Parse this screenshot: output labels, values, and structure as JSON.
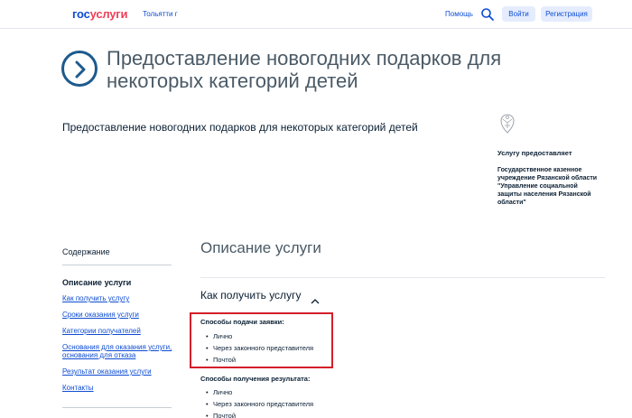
{
  "header": {
    "logo_part1": "гос",
    "logo_part2": "услуги",
    "city": "Тольятти г",
    "help": "Помощь",
    "login": "Войти",
    "register": "Регистрация"
  },
  "page": {
    "title": "Предоставление новогодних подарков для некоторых категорий детей",
    "subheading": "Предоставление новогодних подарков для некоторых категорий детей"
  },
  "provider": {
    "label": "Услугу предоставляет",
    "name": "Государственное казенное учреждение Рязанской области \"Управление социальной защиты населения Рязанской области\""
  },
  "sidebar": {
    "title": "Содержание",
    "active": "Описание услуги",
    "items": [
      "Как получить услугу",
      "Сроки оказания услуги",
      "Категории получателей",
      "Основания для оказания услуги, основания для отказа",
      "Результат оказания услуги",
      "Контакты"
    ]
  },
  "main": {
    "section_title": "Описание услуги",
    "accordion_title": "Как получить услугу",
    "submit_title": "Способы подачи заявки:",
    "submit_methods": [
      "Лично",
      "Через законного представителя",
      "Почтой"
    ],
    "result_title": "Способы получения результата:",
    "result_methods": [
      "Лично",
      "Через законного представителя",
      "Почтой"
    ]
  },
  "colors": {
    "brand_blue": "#0d4cd3",
    "brand_red": "#ee3f58",
    "highlight_red": "#d41f2a"
  }
}
